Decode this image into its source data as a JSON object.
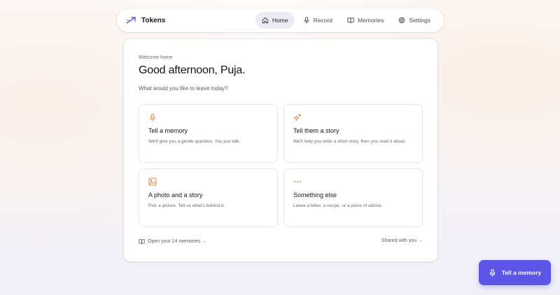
{
  "app": {
    "name": "Tokens"
  },
  "nav": {
    "items": [
      {
        "label": "Home",
        "icon": "home-icon",
        "active": true
      },
      {
        "label": "Record",
        "icon": "microphone-icon",
        "active": false
      },
      {
        "label": "Memories",
        "icon": "book-icon",
        "active": false
      },
      {
        "label": "Settings",
        "icon": "gear-icon",
        "active": false
      }
    ]
  },
  "main": {
    "eyebrow": "Welcome home",
    "greeting": "Good afternoon, Puja.",
    "prompt": "What would you like to leave today?",
    "options": [
      {
        "title": "Tell a memory",
        "description": "We'll give you a gentle question. You just talk.",
        "icon": "microphone-icon"
      },
      {
        "title": "Tell them a story",
        "description": "We'll help you write a short story, then you read it aloud.",
        "icon": "sparkles-icon"
      },
      {
        "title": "A photo and a story",
        "description": "Pick a picture. Tell us what's behind it.",
        "icon": "image-icon"
      },
      {
        "title": "Something else",
        "description": "Leave a letter, a recipe, or a piece of advice.",
        "icon": "more-dots-icon"
      }
    ],
    "footer": {
      "memories_link": "Open your 14 memories →",
      "shared_link": "Shared with you →"
    }
  },
  "fab": {
    "label": "Tell a memory",
    "icon": "microphone-icon"
  },
  "colors": {
    "accent": "#5b56e8",
    "icon_accent": "#d9864a",
    "nav_active_bg": "#ececf6"
  }
}
